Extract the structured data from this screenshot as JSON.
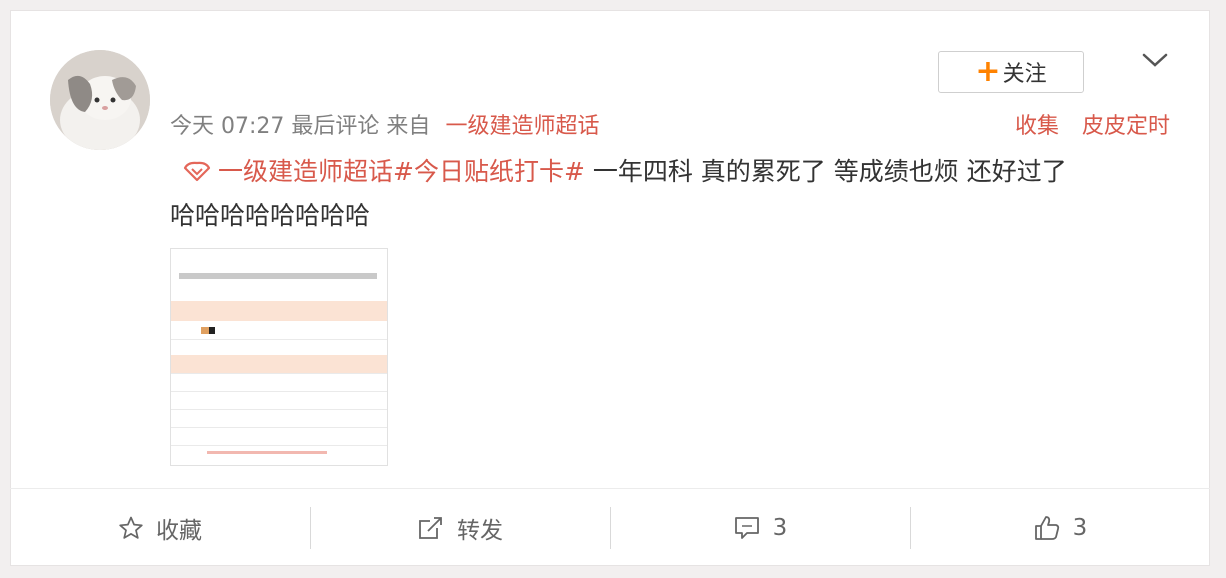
{
  "header": {
    "follow_label": "关注",
    "timestamp": "今天 07:27",
    "last_comment": "最后评论",
    "from_label": "来自",
    "source": "一级建造师超话",
    "collect_link": "收集",
    "scheduler_link": "皮皮定时"
  },
  "post": {
    "topic": "一级建造师超话#今日贴纸打卡#",
    "text_line1": " 一年四科 真的累死了 等成绩也烦 还好过了",
    "text_line2": "哈哈哈哈哈哈哈哈"
  },
  "footer": {
    "favorite_label": "收藏",
    "repost_label": "转发",
    "comment_count": "3",
    "like_count": "3"
  },
  "colors": {
    "accent": "#d8594b",
    "follow_plus": "#ff8200",
    "text": "#333333",
    "meta": "#808080",
    "background": "#f2efef"
  },
  "icons": [
    "avatar-cat",
    "plus-icon",
    "chevron-down-icon",
    "supertopic-icon",
    "star-icon",
    "repost-icon",
    "comment-icon",
    "like-icon"
  ]
}
